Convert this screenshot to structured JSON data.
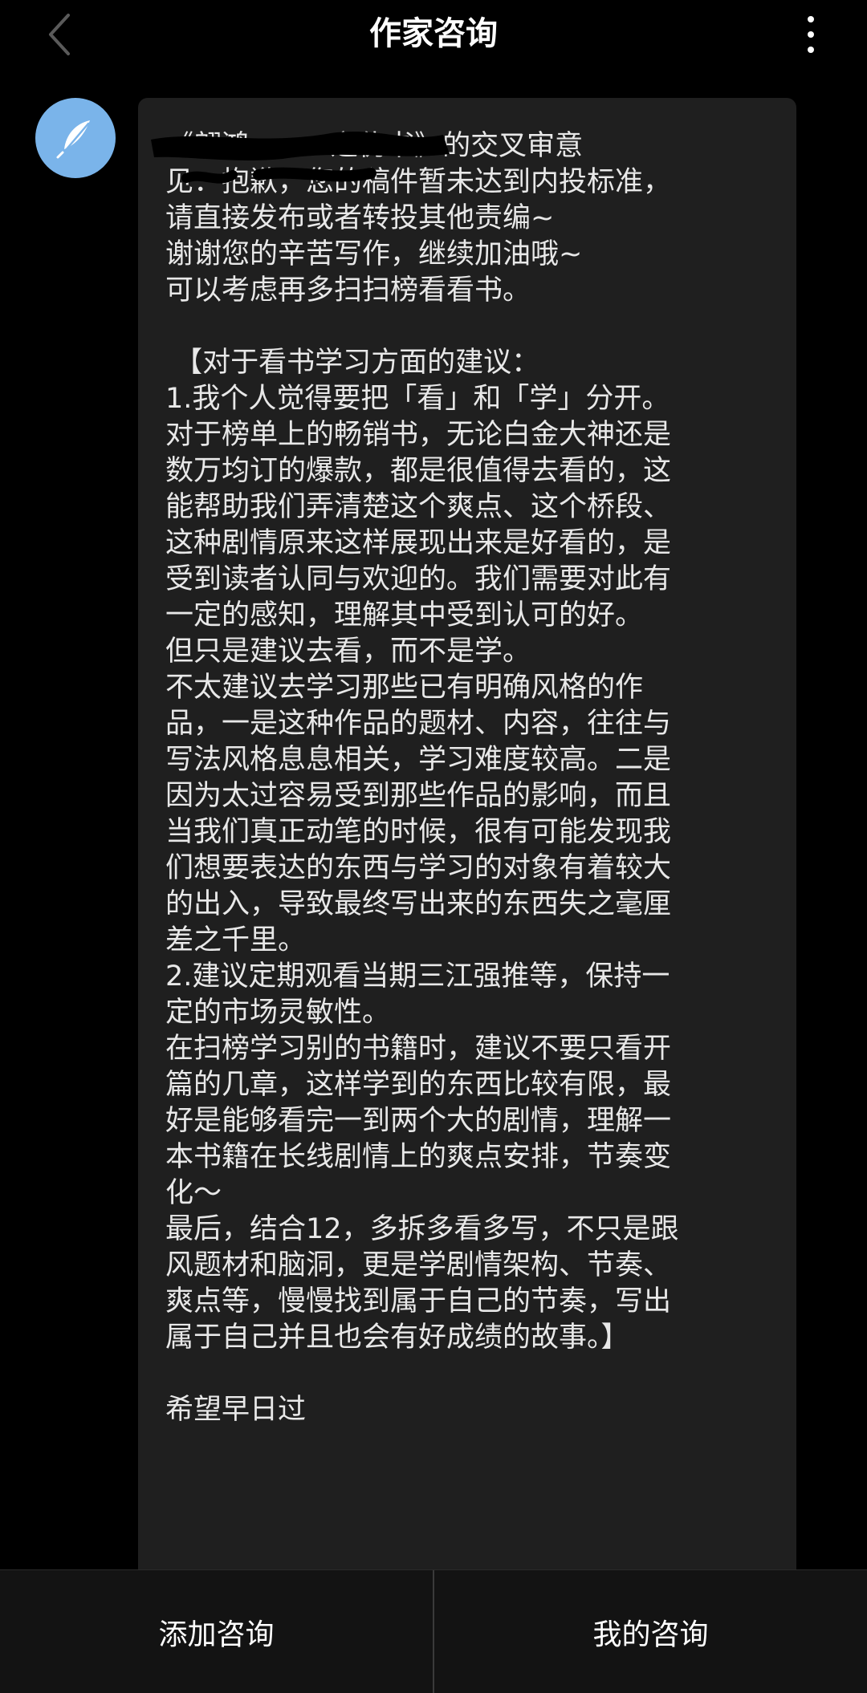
{
  "header": {
    "title": "作家咨询"
  },
  "message": {
    "lines": [
      "《翩鸿·········之伪书》的交叉审意",
      "见：抱歉，您的稿件暂未达到内投标准，",
      "请直接发布或者转投其他责编~",
      "谢谢您的辛苦写作，继续加油哦~",
      "可以考虑再多扫扫榜看看书。",
      "",
      " 【对于看书学习方面的建议：",
      "1.我个人觉得要把「看」和「学」分开。",
      "对于榜单上的畅销书，无论白金大神还是",
      "数万均订的爆款，都是很值得去看的，这",
      "能帮助我们弄清楚这个爽点、这个桥段、",
      "这种剧情原来这样展现出来是好看的，是",
      "受到读者认同与欢迎的。我们需要对此有",
      "一定的感知，理解其中受到认可的好。",
      "但只是建议去看，而不是学。",
      "不太建议去学习那些已有明确风格的作",
      "品，一是这种作品的题材、内容，往往与",
      "写法风格息息相关，学习难度较高。二是",
      "因为太过容易受到那些作品的影响，而且",
      "当我们真正动笔的时候，很有可能发现我",
      "们想要表达的东西与学习的对象有着较大",
      "的出入，导致最终写出来的东西失之毫厘",
      "差之千里。",
      "2.建议定期观看当期三江强推等，保持一",
      "定的市场灵敏性。",
      "在扫榜学习别的书籍时，建议不要只看开",
      "篇的几章，这样学到的东西比较有限，最",
      "好是能够看完一到两个大的剧情，理解一",
      "本书籍在长线剧情上的爽点安排，节奏变",
      "化～",
      "最后，结合12，多拆多看多写，不只是跟",
      "风题材和脑洞，更是学剧情架构、节奏、",
      "爽点等，慢慢找到属于自己的节奏，写出",
      "属于自己并且也会有好成绩的故事。】",
      "",
      "希望早日过"
    ]
  },
  "bottom_bar": {
    "add_label": "添加咨询",
    "mine_label": "我的咨询"
  },
  "colors": {
    "background": "#000000",
    "bubble": "#1f1f1f",
    "avatar": "#7ab4ea",
    "text": "#e8e8e8"
  },
  "icons": {
    "back": "chevron-left-icon",
    "more": "more-vertical-icon",
    "avatar": "feather-icon"
  }
}
